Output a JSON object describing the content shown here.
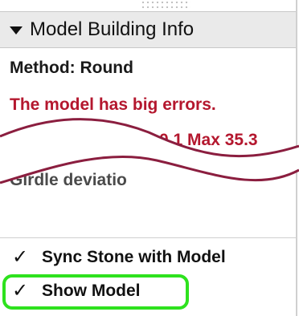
{
  "panel": {
    "header": {
      "title": "Model Building Info",
      "icon": "triangle-down-icon"
    },
    "method_text": "Method: Round",
    "error_line_1": "The model has big errors.",
    "error_line_2_partial": "0.1 Max 35.3",
    "girdle_partial": "Girdle deviatio",
    "options": [
      {
        "label": "Sync Stone with Model",
        "checked": true,
        "check_glyph": "✓"
      },
      {
        "label": "Show Model",
        "checked": true,
        "check_glyph": "✓"
      }
    ]
  },
  "colors": {
    "error_text": "#b4172e",
    "wave_line": "#8b1e3f",
    "highlight": "#2ee21e",
    "header_bg": "#eaeaea"
  }
}
